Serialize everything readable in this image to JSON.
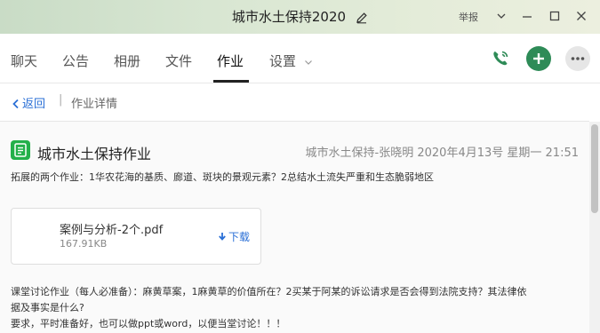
{
  "window": {
    "title": "城市水土保持2020",
    "report_label": "举报"
  },
  "tabs": [
    {
      "label": "聊天"
    },
    {
      "label": "公告"
    },
    {
      "label": "相册"
    },
    {
      "label": "文件"
    },
    {
      "label": "作业",
      "active": true
    },
    {
      "label": "设置"
    }
  ],
  "breadcrumb": {
    "back_label": "返回",
    "separator": "|",
    "title": "作业详情"
  },
  "homework": {
    "title": "城市水土保持作业",
    "meta": "城市水土保持-张晓明 2020年4月13号 星期一 21:51",
    "description": "拓展的两个作业：1华农花海的基质、廊道、斑块的景观元素？2总结水土流失严重和生态脆弱地区",
    "attachment": {
      "name": "案例与分析-2个.pdf",
      "size": "167.91KB",
      "download_label": "下载"
    },
    "notes": [
      "课堂讨论作业（每人必准备）：麻黄草案，1麻黄草的价值所在？2买某于阿某的诉讼请求是否会得到法院支持？其法律依",
      "据及事实是什么?",
      "要求，平时准备好，也可以做ppt或word，以便当堂讨论！！！"
    ]
  },
  "colors": {
    "accent_blue": "#2a6fd6",
    "accent_green": "#23b04a",
    "titlebar_green": "#c9dcc6"
  },
  "icons": [
    "edit-icon",
    "minimize-icon",
    "maximize-icon",
    "close-icon",
    "chevron-down-icon",
    "phone-icon",
    "plus-icon",
    "more-icon",
    "back-chevron-icon",
    "homework-icon",
    "download-icon"
  ]
}
